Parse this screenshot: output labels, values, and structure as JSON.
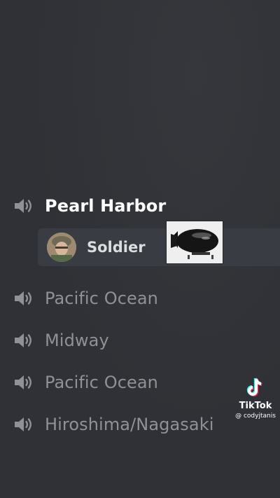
{
  "channels": [
    {
      "label": "Pearl Harbor",
      "icon": "speaker-icon",
      "active": true
    },
    {
      "label": "Pacific Ocean",
      "icon": "speaker-icon",
      "active": false
    },
    {
      "label": "Midway",
      "icon": "speaker-icon",
      "active": false
    },
    {
      "label": "Pacific Ocean",
      "icon": "speaker-icon",
      "active": false
    },
    {
      "label": "Hiroshima/Nagasaki",
      "icon": "speaker-icon",
      "active": false
    }
  ],
  "voice_user": {
    "name": "Soldier",
    "avatar_icon": "soldier-avatar"
  },
  "stream_preview": {
    "icon": "bomb-image"
  },
  "watermark": {
    "brand": "TikTok",
    "handle": "@ codyjtanis"
  },
  "colors": {
    "background": "#2f3136",
    "channel_text": "#8e9297",
    "active_text": "#ffffff",
    "user_row": "#393c43"
  }
}
